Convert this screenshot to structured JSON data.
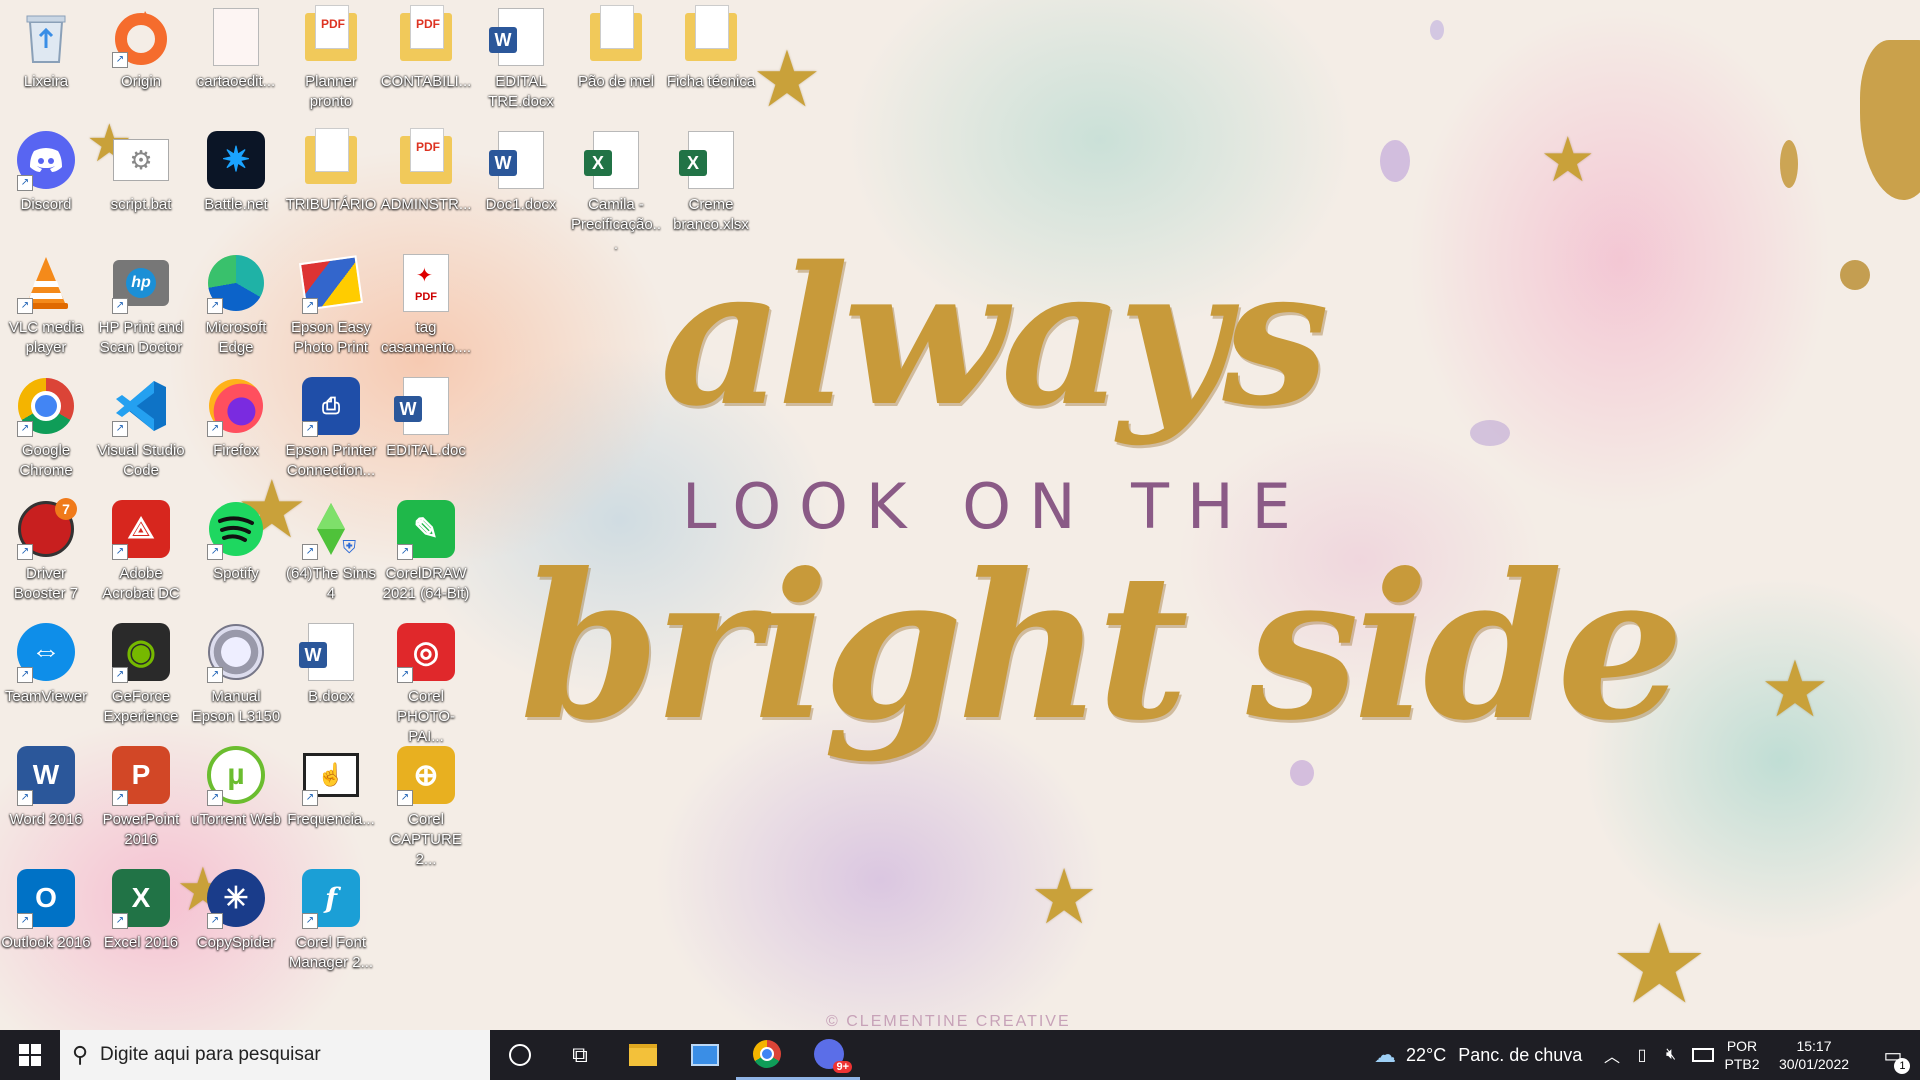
{
  "wallpaper": {
    "line1": "always",
    "line2": "LOOK ON THE",
    "line3": "bright side",
    "credit": "© CLEMENTINE CREATIVE"
  },
  "desktop_icons": [
    {
      "label": "Lixeira",
      "icon": "recycle-bin-icon"
    },
    {
      "label": "Origin",
      "icon": "origin-icon"
    },
    {
      "label": "cartaoedit...",
      "icon": "document-icon"
    },
    {
      "label": "Planner pronto",
      "icon": "pdf-folder-icon"
    },
    {
      "label": "CONTABILI...",
      "icon": "pdf-folder-icon"
    },
    {
      "label": "EDITAL TRE.docx",
      "icon": "word-doc-icon"
    },
    {
      "label": "Pão de mel",
      "icon": "folder-icon"
    },
    {
      "label": "Ficha técnica",
      "icon": "folder-icon"
    },
    {
      "label": "Discord",
      "icon": "discord-icon"
    },
    {
      "label": "script.bat",
      "icon": "bat-file-icon"
    },
    {
      "label": "Battle.net",
      "icon": "battlenet-icon"
    },
    {
      "label": "TRIBUTÁRIO",
      "icon": "folder-icon"
    },
    {
      "label": "ADMINSTR...",
      "icon": "pdf-folder-icon"
    },
    {
      "label": "Doc1.docx",
      "icon": "word-doc-icon"
    },
    {
      "label": "Camila - Precificação...",
      "icon": "excel-doc-icon"
    },
    {
      "label": "Creme branco.xlsx",
      "icon": "excel-doc-icon"
    },
    {
      "label": "VLC media player",
      "icon": "vlc-icon"
    },
    {
      "label": "HP Print and Scan Doctor",
      "icon": "hp-icon"
    },
    {
      "label": "Microsoft Edge",
      "icon": "edge-icon"
    },
    {
      "label": "Epson Easy Photo Print",
      "icon": "epson-photo-icon"
    },
    {
      "label": "tag casamento....",
      "icon": "pdf-icon"
    },
    {
      "label": "Google Chrome",
      "icon": "chrome-icon"
    },
    {
      "label": "Visual Studio Code",
      "icon": "vscode-icon"
    },
    {
      "label": "Firefox",
      "icon": "firefox-icon"
    },
    {
      "label": "Epson Printer Connection...",
      "icon": "epson-printer-icon"
    },
    {
      "label": "EDITAL.doc",
      "icon": "word-doc-icon"
    },
    {
      "label": "Driver Booster 7",
      "icon": "driver-booster-icon"
    },
    {
      "label": "Adobe Acrobat DC",
      "icon": "acrobat-icon"
    },
    {
      "label": "Spotify",
      "icon": "spotify-icon"
    },
    {
      "label": "(64)The Sims 4",
      "icon": "sims-icon"
    },
    {
      "label": "CorelDRAW 2021 (64-Bit)",
      "icon": "coreldraw-icon"
    },
    {
      "label": "TeamViewer",
      "icon": "teamviewer-icon"
    },
    {
      "label": "GeForce Experience",
      "icon": "geforce-icon"
    },
    {
      "label": "Manual Epson L3150",
      "icon": "manual-icon"
    },
    {
      "label": "B.docx",
      "icon": "word-doc-icon"
    },
    {
      "label": "Corel PHOTO-PAI...",
      "icon": "corel-photopaint-icon"
    },
    {
      "label": "Word 2016",
      "icon": "word-icon"
    },
    {
      "label": "PowerPoint 2016",
      "icon": "powerpoint-icon"
    },
    {
      "label": "uTorrent Web",
      "icon": "utorrent-icon"
    },
    {
      "label": "Frequencia...",
      "icon": "frequencia-icon"
    },
    {
      "label": "Corel CAPTURE 2...",
      "icon": "corel-capture-icon"
    },
    {
      "label": "Outlook 2016",
      "icon": "outlook-icon"
    },
    {
      "label": "Excel 2016",
      "icon": "excel-icon"
    },
    {
      "label": "CopySpider",
      "icon": "copyspider-icon"
    },
    {
      "label": "Corel Font Manager 2...",
      "icon": "corel-font-icon"
    }
  ],
  "badges": {
    "driver_booster": "7",
    "chrome_notif": "9+"
  },
  "taskbar": {
    "search_placeholder": "Digite aqui para pesquisar",
    "weather_temp": "22°C",
    "weather_desc": "Panc. de chuva",
    "lang_1": "POR",
    "lang_2": "PTB2",
    "time": "15:17",
    "date": "30/01/2022",
    "notification_count": "1"
  }
}
